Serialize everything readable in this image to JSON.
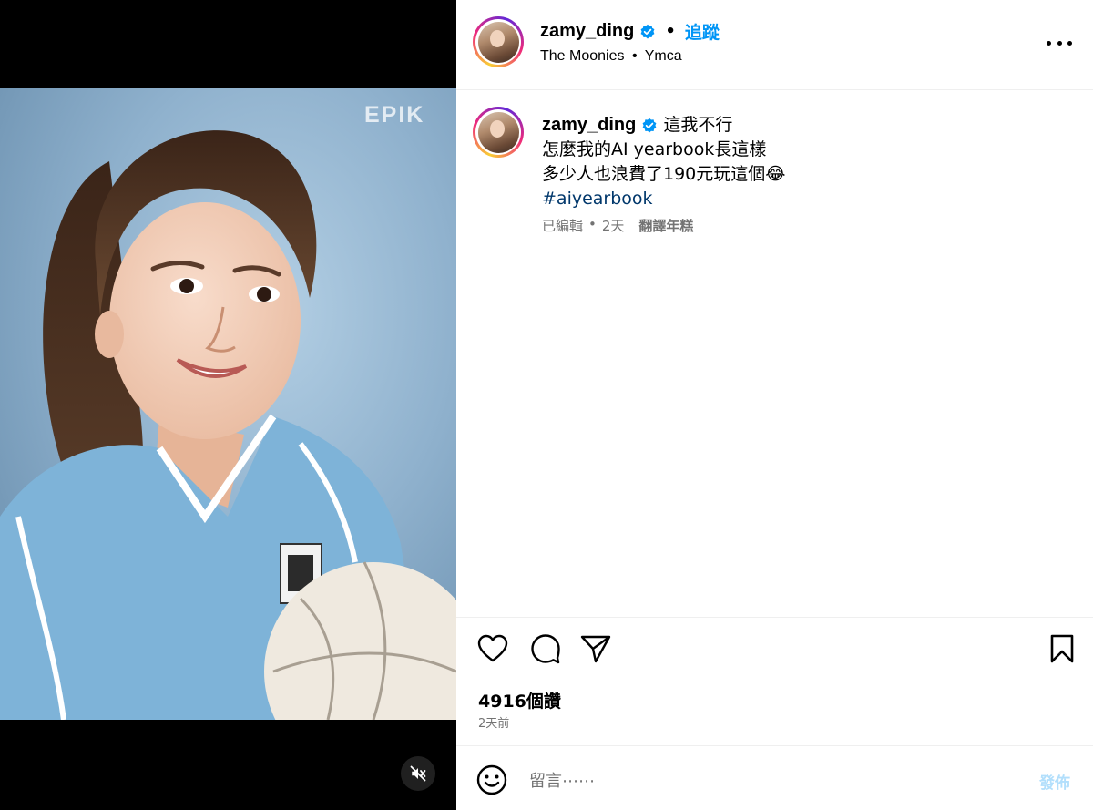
{
  "media": {
    "watermark": "EPIK",
    "mute_icon": "speaker-muted-icon"
  },
  "header": {
    "username": "zamy_ding",
    "separator": "•",
    "follow_label": "追蹤",
    "audio_artist": "The Moonies",
    "audio_sep": "•",
    "audio_title": "Ymca",
    "verified_color": "#0095f6"
  },
  "caption": {
    "username": "zamy_ding",
    "line1": "這我不行",
    "line2": "怎麼我的AI yearbook長這樣",
    "line3": "多少人也浪費了190元玩這個😂",
    "hashtag": "#aiyearbook",
    "edited": "已編輯",
    "dot": "•",
    "age": "2天",
    "translate_label": "翻譯年糕"
  },
  "stats": {
    "views": "4916個讚",
    "posted": "2天前"
  },
  "comment": {
    "placeholder": "留言⋯⋯",
    "post_label": "發佈"
  },
  "colors": {
    "accent": "#0095f6",
    "hashtag": "#00376b",
    "muted_text": "#737373",
    "post_disabled": "#b2dffc"
  }
}
